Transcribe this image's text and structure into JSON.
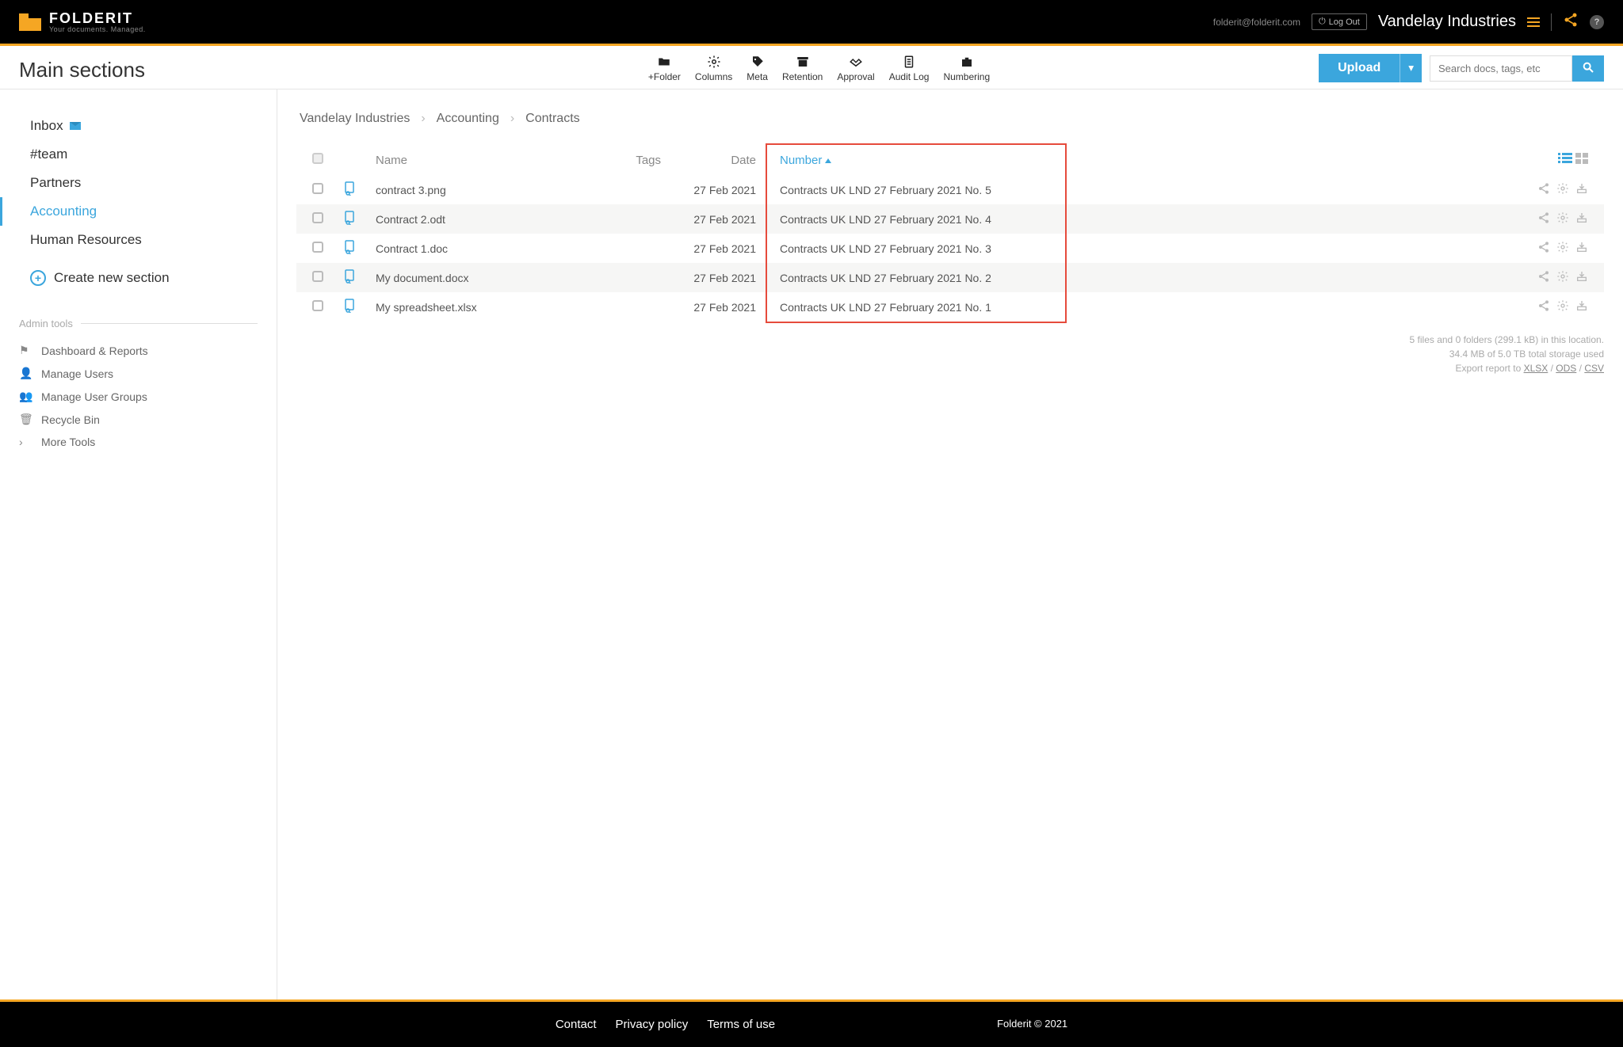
{
  "header": {
    "brand": "FOLDERIT",
    "tagline": "Your documents. Managed.",
    "user_email": "folderit@folderit.com",
    "logout_label": "Log Out",
    "org_name": "Vandelay Industries"
  },
  "toolbar": {
    "title": "Main sections",
    "buttons": [
      {
        "id": "add-folder",
        "label": "+Folder"
      },
      {
        "id": "columns",
        "label": "Columns"
      },
      {
        "id": "meta",
        "label": "Meta"
      },
      {
        "id": "retention",
        "label": "Retention"
      },
      {
        "id": "approval",
        "label": "Approval"
      },
      {
        "id": "audit-log",
        "label": "Audit Log"
      },
      {
        "id": "numbering",
        "label": "Numbering"
      }
    ],
    "upload_label": "Upload",
    "search_placeholder": "Search docs, tags, etc"
  },
  "sidebar": {
    "sections": [
      {
        "label": "Inbox",
        "icon": "envelope"
      },
      {
        "label": "#team"
      },
      {
        "label": "Partners"
      },
      {
        "label": "Accounting",
        "active": true
      },
      {
        "label": "Human Resources"
      }
    ],
    "create_label": "Create new section",
    "admin_header": "Admin tools",
    "admin_items": [
      {
        "label": "Dashboard & Reports",
        "icon": "flag"
      },
      {
        "label": "Manage Users",
        "icon": "user"
      },
      {
        "label": "Manage User Groups",
        "icon": "users"
      },
      {
        "label": "Recycle Bin",
        "icon": "trash"
      },
      {
        "label": "More Tools",
        "icon": "chevron"
      }
    ]
  },
  "breadcrumb": [
    "Vandelay Industries",
    "Accounting",
    "Contracts"
  ],
  "table": {
    "columns": {
      "name": "Name",
      "tags": "Tags",
      "date": "Date",
      "number": "Number"
    },
    "sort_column": "Number",
    "sort_dir": "asc",
    "rows": [
      {
        "name": "contract 3.png",
        "date": "27 Feb 2021",
        "number": "Contracts UK LND 27 February 2021 No. 5"
      },
      {
        "name": "Contract 2.odt",
        "date": "27 Feb 2021",
        "number": "Contracts UK LND 27 February 2021 No. 4"
      },
      {
        "name": "Contract 1.doc",
        "date": "27 Feb 2021",
        "number": "Contracts UK LND 27 February 2021 No. 3"
      },
      {
        "name": "My document.docx",
        "date": "27 Feb 2021",
        "number": "Contracts UK LND 27 February 2021 No. 2"
      },
      {
        "name": "My spreadsheet.xlsx",
        "date": "27 Feb 2021",
        "number": "Contracts UK LND 27 February 2021 No. 1"
      }
    ]
  },
  "stats": {
    "line1": "5 files and 0 folders (299.1 kB) in this location.",
    "line2": "34.4 MB of 5.0 TB total storage used",
    "export_prefix": "Export report to ",
    "export_formats": [
      "XLSX",
      "ODS",
      "CSV"
    ]
  },
  "footer": {
    "links": [
      "Contact",
      "Privacy policy",
      "Terms of use"
    ],
    "copyright": "Folderit © 2021"
  }
}
